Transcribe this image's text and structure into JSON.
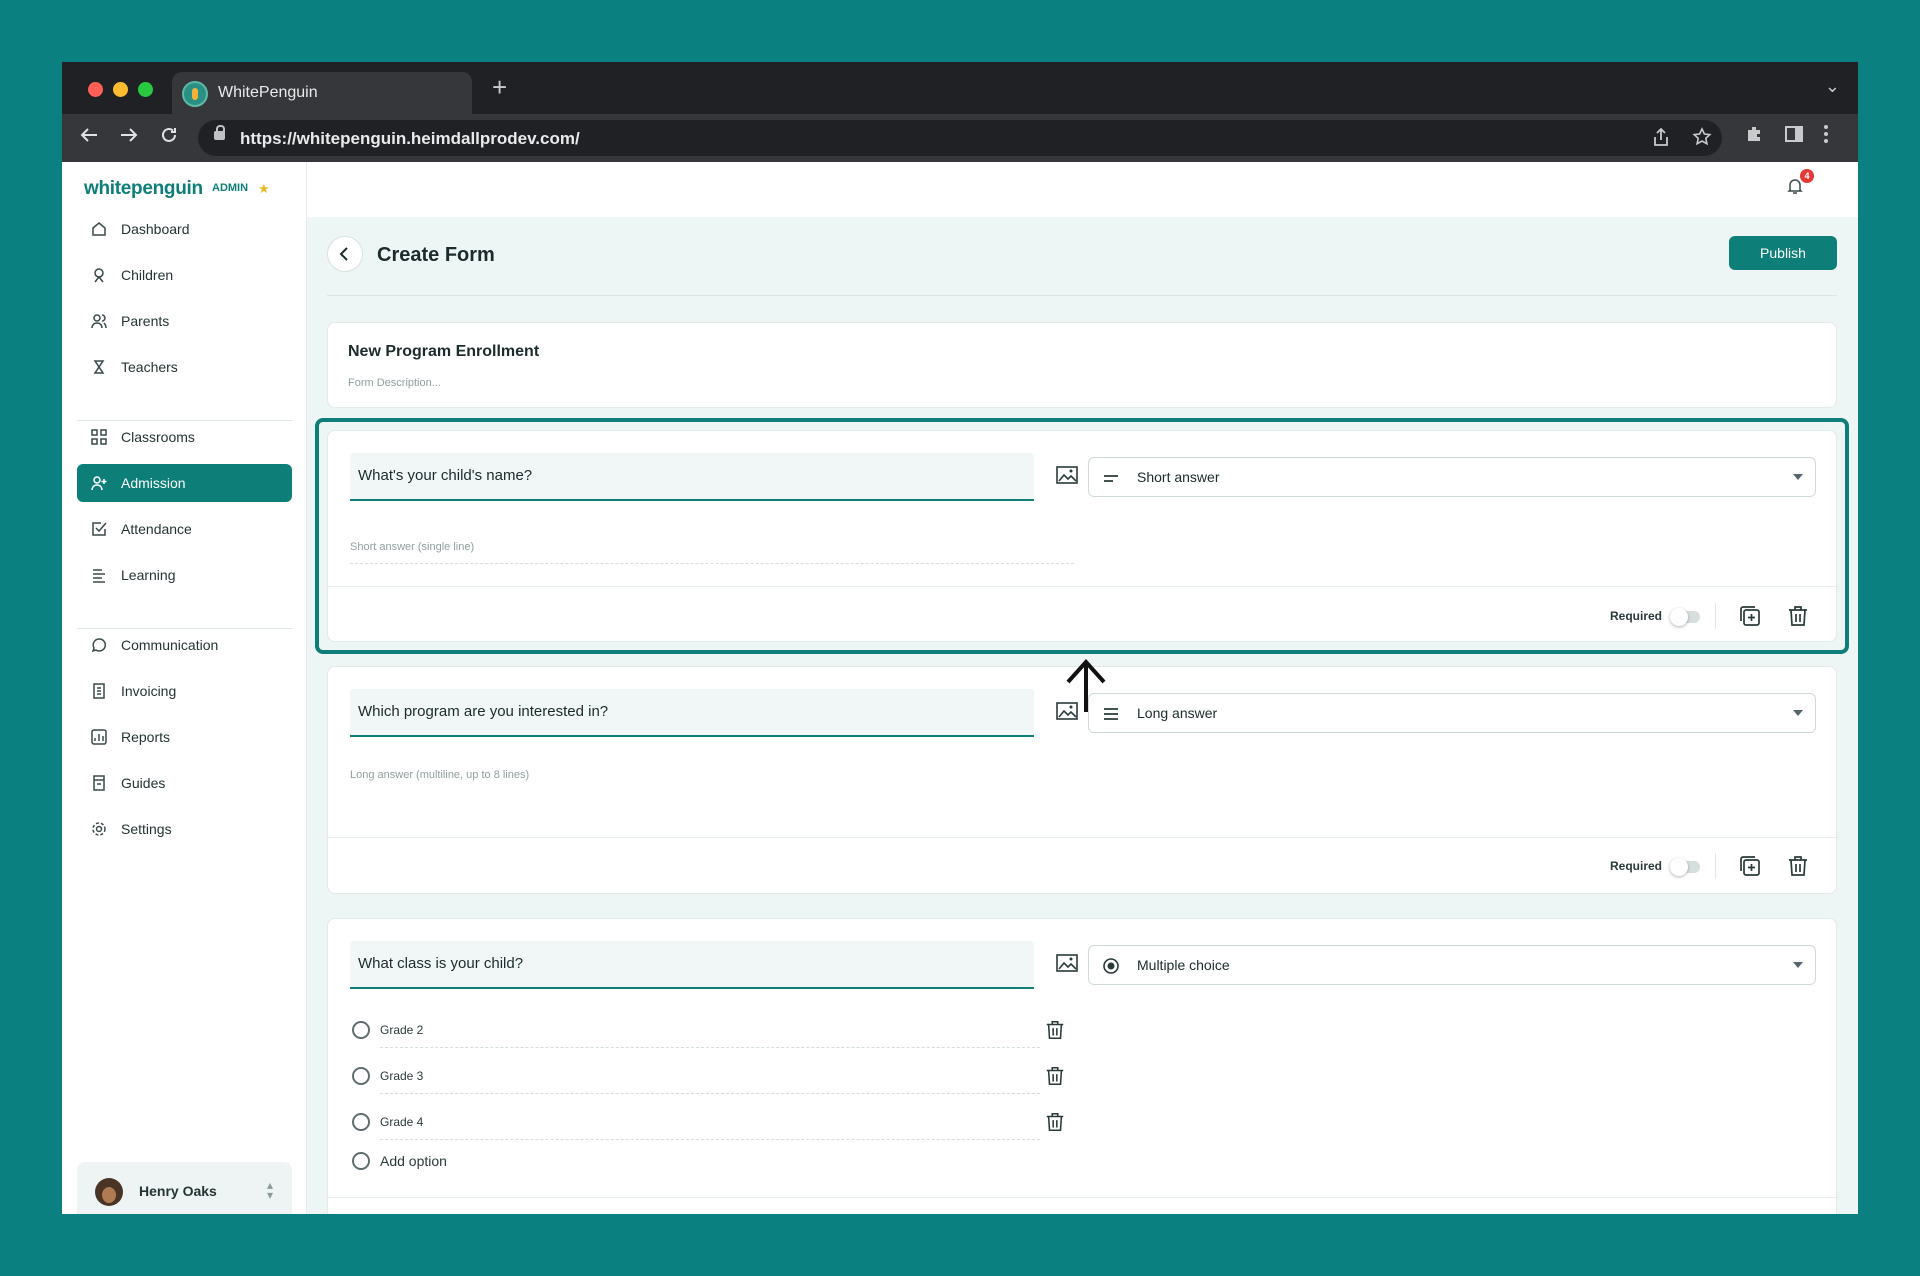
{
  "browser": {
    "tab_title": "WhitePenguin",
    "url": "https://whitepenguin.heimdallprodev.com/"
  },
  "sidebar": {
    "logo": "whitepenguin",
    "logo_badge": "ADMIN",
    "items": [
      {
        "label": "Dashboard",
        "icon": "home-icon"
      },
      {
        "label": "Children",
        "icon": "child-icon"
      },
      {
        "label": "Parents",
        "icon": "parents-icon"
      },
      {
        "label": "Teachers",
        "icon": "teacher-icon"
      },
      {
        "label": "Classrooms",
        "icon": "grid-icon"
      },
      {
        "label": "Admission",
        "icon": "user-plus-icon",
        "active": true
      },
      {
        "label": "Attendance",
        "icon": "check-square-icon"
      },
      {
        "label": "Learning",
        "icon": "learning-icon"
      },
      {
        "label": "Communication",
        "icon": "chat-icon"
      },
      {
        "label": "Invoicing",
        "icon": "invoice-icon"
      },
      {
        "label": "Reports",
        "icon": "chart-icon"
      },
      {
        "label": "Guides",
        "icon": "book-icon"
      },
      {
        "label": "Settings",
        "icon": "gear-icon"
      }
    ],
    "user": {
      "name": "Henry Oaks"
    }
  },
  "header": {
    "notification_count": "4",
    "page_title": "Create Form",
    "publish_label": "Publish"
  },
  "form": {
    "title": "New Program Enrollment",
    "description_placeholder": "Form Description..."
  },
  "questions": [
    {
      "question": "What's your child's name?",
      "type": "Short answer",
      "hint": "Short answer (single line)",
      "required_label": "Required"
    },
    {
      "question": "Which program are you interested in?",
      "type": "Long answer",
      "hint": "Long answer (multiline, up to 8 lines)",
      "required_label": "Required"
    },
    {
      "question": "What class is your child?",
      "type": "Multiple choice",
      "options": [
        "Grade 2",
        "Grade 3",
        "Grade 4"
      ],
      "add_option": "Add option"
    }
  ],
  "colors": {
    "background": "#0a8080",
    "accent": "#0d7e78"
  }
}
